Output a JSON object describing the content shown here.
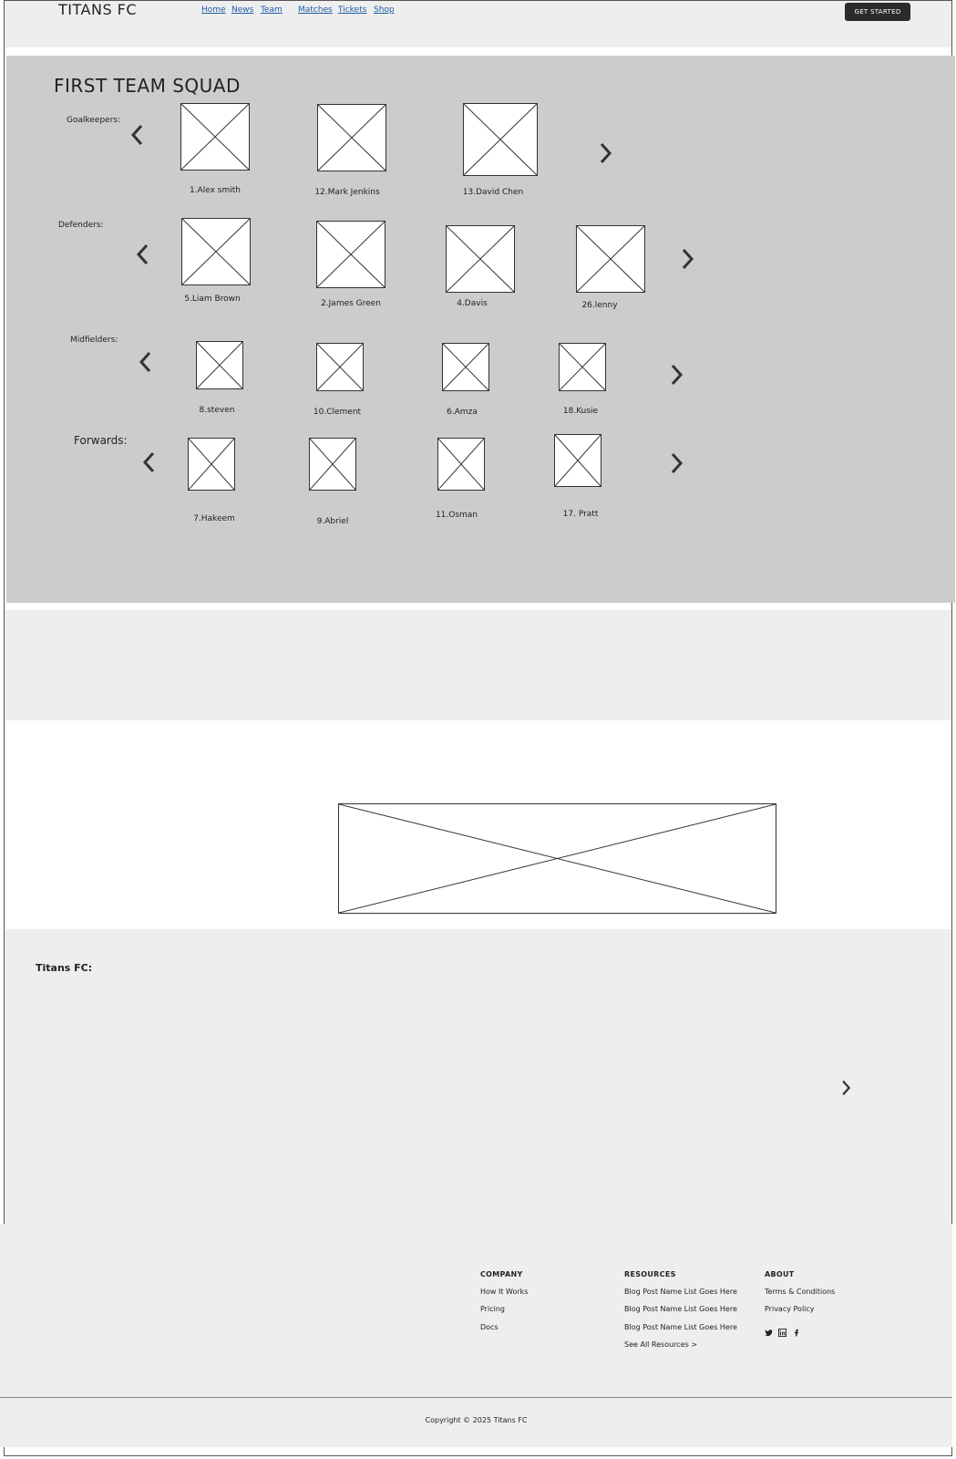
{
  "header": {
    "brand": "TITANS FC",
    "nav": [
      "Home",
      "News",
      "Team",
      "Matches",
      "Tickets",
      "Shop"
    ],
    "cta_label": "GET STARTED"
  },
  "squad": {
    "title": "FIRST TEAM SQUAD",
    "groups": [
      {
        "label": "Goalkeepers:",
        "players": [
          "1.Alex smith",
          "12.Mark Jenkins",
          "13.David Chen"
        ]
      },
      {
        "label": "Defenders:",
        "players": [
          "5.Liam Brown",
          "2.James Green",
          "4.Davis",
          "26.lenny"
        ]
      },
      {
        "label": "Midfielders:",
        "players": [
          "8.steven",
          "10.Clement",
          "6.Amza",
          "18.Kusie"
        ]
      },
      {
        "label": "Forwards:",
        "players": [
          "7.Hakeem",
          "9.Abriel",
          "11.Osman",
          "17. Pratt"
        ]
      }
    ]
  },
  "club_section": {
    "label": "Titans FC:"
  },
  "footer": {
    "company": {
      "heading": "COMPANY",
      "items": [
        "How It Works",
        "Pricing",
        "Docs"
      ]
    },
    "resources": {
      "heading": "RESOURCES",
      "items": [
        "Blog Post Name List Goes Here",
        "Blog Post Name List Goes Here",
        "Blog Post Name List Goes Here",
        "See All Resources >"
      ]
    },
    "about": {
      "heading": "ABOUT",
      "items": [
        "Terms & Conditions",
        "Privacy Policy"
      ]
    },
    "social_icons": [
      "twitter-icon",
      "linkedin-icon",
      "facebook-icon"
    ],
    "copyright": "Copyright © 2025 Titans FC"
  },
  "colors": {
    "header_bg": "#eeeeee",
    "squad_bg": "#cccccc",
    "cta_bg": "#2b2b2b",
    "link": "#1e5aa8"
  }
}
